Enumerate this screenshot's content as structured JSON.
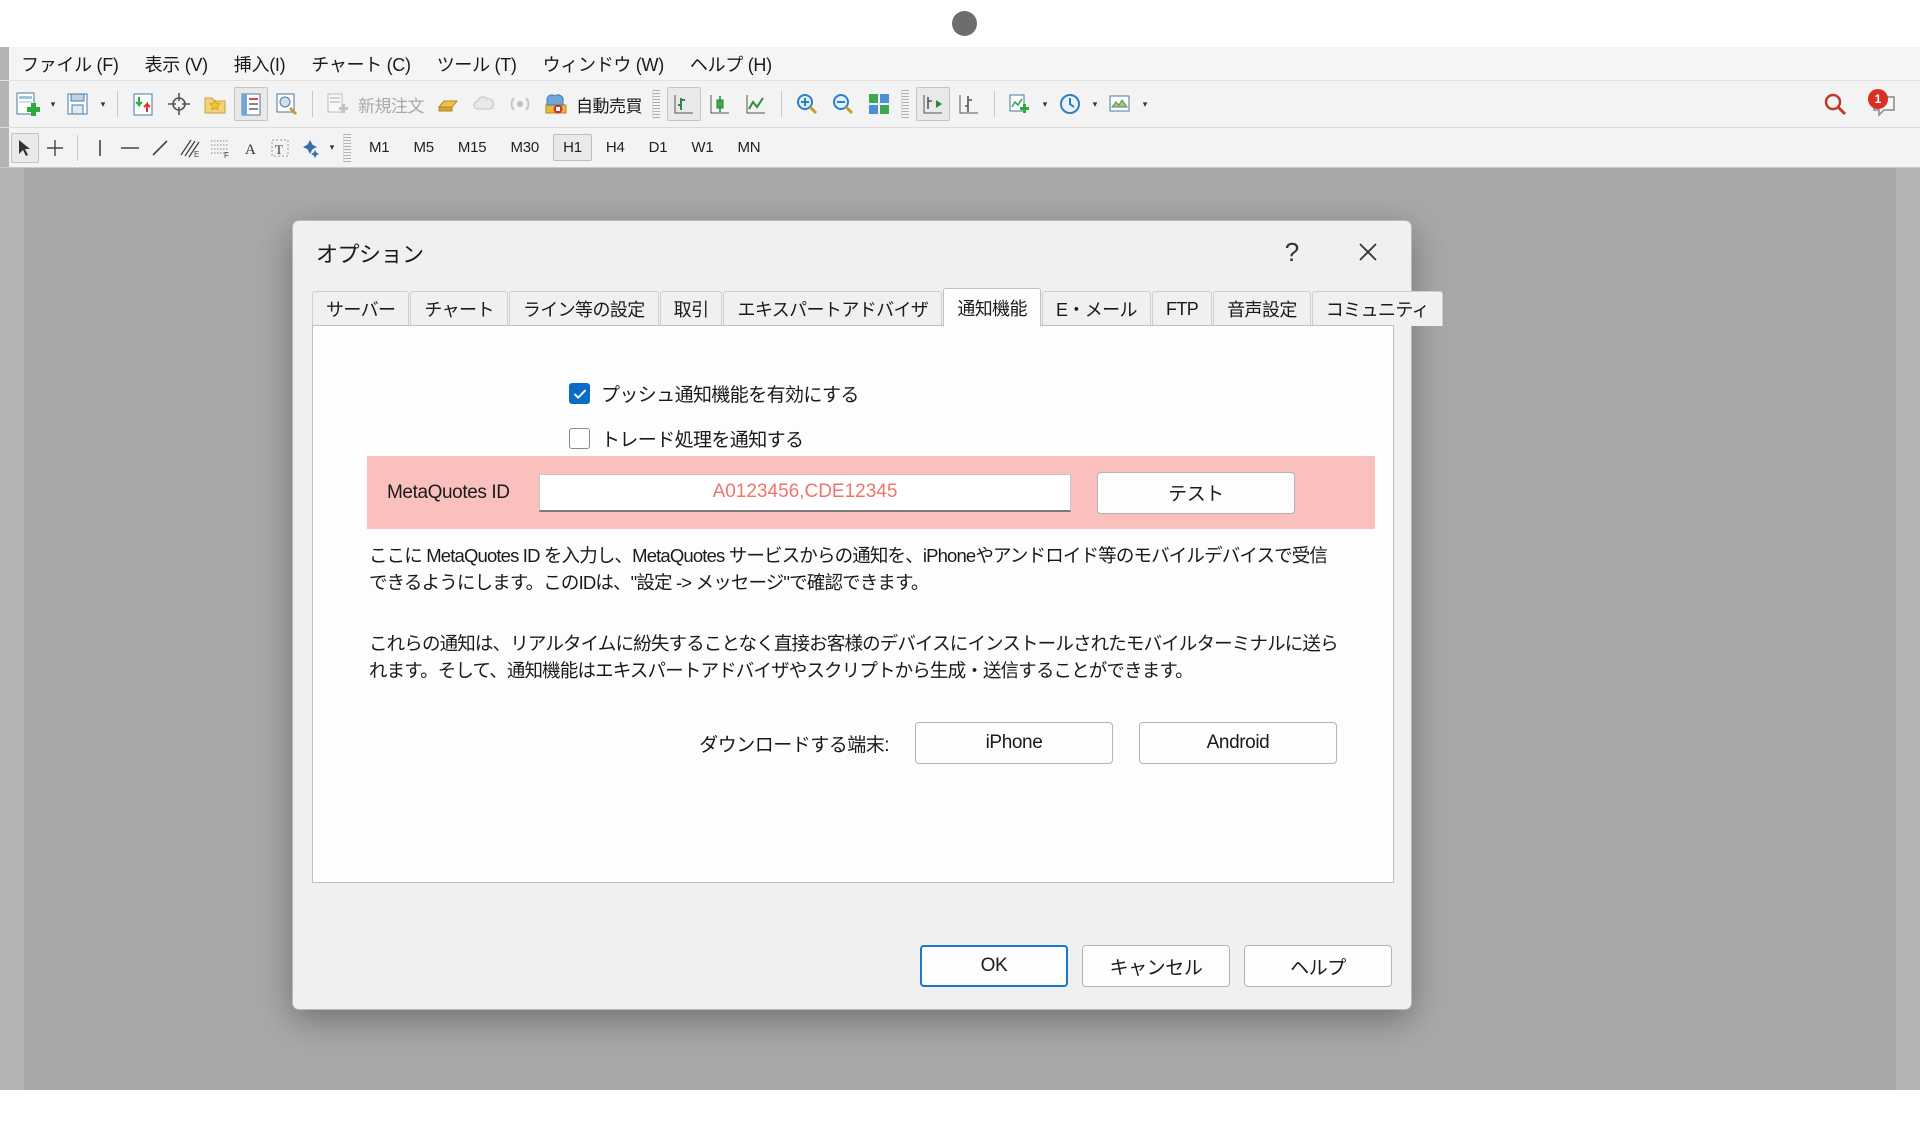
{
  "window": {
    "title_dot": "window-control-dot"
  },
  "menubar": {
    "items": [
      {
        "label": "ファイル (F)",
        "name": "menu-file"
      },
      {
        "label": "表示 (V)",
        "name": "menu-view"
      },
      {
        "label": "挿入(I)",
        "name": "menu-insert"
      },
      {
        "label": "チャート (C)",
        "name": "menu-chart"
      },
      {
        "label": "ツール (T)",
        "name": "menu-tools"
      },
      {
        "label": "ウィンドウ (W)",
        "name": "menu-window"
      },
      {
        "label": "ヘルプ (H)",
        "name": "menu-help"
      }
    ]
  },
  "toolbar": {
    "new_order_label": "新規注文",
    "autotrading_label": "自動売買",
    "notification_badge": "1",
    "timeframes": [
      {
        "label": "M1",
        "active": false
      },
      {
        "label": "M5",
        "active": false
      },
      {
        "label": "M15",
        "active": false
      },
      {
        "label": "M30",
        "active": false
      },
      {
        "label": "H1",
        "active": true
      },
      {
        "label": "H4",
        "active": false
      },
      {
        "label": "D1",
        "active": false
      },
      {
        "label": "W1",
        "active": false
      },
      {
        "label": "MN",
        "active": false
      }
    ]
  },
  "dialog": {
    "title": "オプション",
    "help_glyph": "?",
    "tabs": [
      {
        "label": "サーバー",
        "name": "tab-server",
        "active": false
      },
      {
        "label": "チャート",
        "name": "tab-chart",
        "active": false
      },
      {
        "label": "ライン等の設定",
        "name": "tab-lines",
        "active": false
      },
      {
        "label": "取引",
        "name": "tab-trade",
        "active": false
      },
      {
        "label": "エキスパートアドバイザ",
        "name": "tab-expert-advisor",
        "active": false
      },
      {
        "label": "通知機能",
        "name": "tab-notifications",
        "active": true
      },
      {
        "label": "E・メール",
        "name": "tab-email",
        "active": false
      },
      {
        "label": "FTP",
        "name": "tab-ftp",
        "active": false
      },
      {
        "label": "音声設定",
        "name": "tab-sound",
        "active": false
      },
      {
        "label": "コミュニティ",
        "name": "tab-community",
        "active": false
      }
    ],
    "notifications": {
      "enable_push_label": "プッシュ通知機能を有効にする",
      "enable_push_checked": true,
      "notify_trade_label": "トレード処理を通知する",
      "notify_trade_checked": false,
      "mqid_label": "MetaQuotes ID",
      "mqid_value": "A0123456,CDE12345",
      "test_button": "テスト",
      "highlight_color": "#f9c0bd",
      "mqid_text_color": "#f0746b",
      "description_1": "ここに MetaQuotes ID を入力し、MetaQuotes サービスからの通知を、iPhoneやアンドロイド等のモバイルデバイスで受信できるようにします。このIDは、\"設定 -> メッセージ\"で確認できます。",
      "description_2": "これらの通知は、リアルタイムに紛失することなく直接お客様のデバイスにインストールされたモバイルターミナルに送られます。そして、通知機能はエキスパートアドバイザやスクリプトから生成・送信することができます。",
      "download_label": "ダウンロードする端末:",
      "download_iphone": "iPhone",
      "download_android": "Android"
    },
    "footer": {
      "ok": "OK",
      "cancel": "キャンセル",
      "help": "ヘルプ"
    }
  }
}
